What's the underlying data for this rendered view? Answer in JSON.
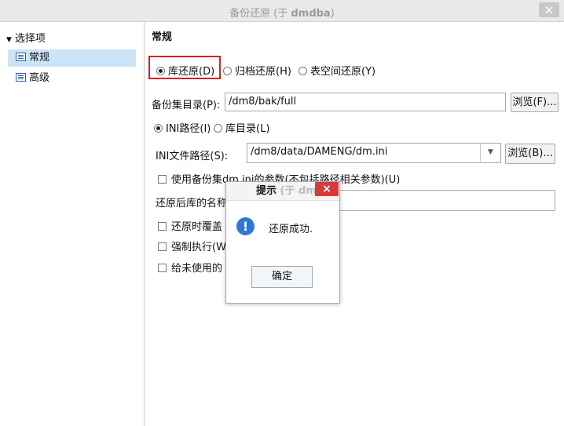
{
  "window": {
    "title_prefix": "备份还原 (于 ",
    "title_user": "dmdba",
    "title_suffix": ")",
    "close_symbol": "×"
  },
  "sidebar": {
    "root_label": "选择项",
    "items": [
      {
        "label": "常规",
        "selected": true
      },
      {
        "label": "高级",
        "selected": false
      }
    ]
  },
  "main": {
    "section_title": "常规",
    "restore_type": {
      "options": [
        {
          "label": "库还原(D)",
          "checked": true
        },
        {
          "label": "归档还原(H)",
          "checked": false
        },
        {
          "label": "表空间还原(Y)",
          "checked": false
        }
      ]
    },
    "backup_dir": {
      "label": "备份集目录(P):",
      "value": "/dm8/bak/full",
      "browse_label": "浏览(F)..."
    },
    "path_mode": {
      "options": [
        {
          "label": "INI路径(I)",
          "checked": true
        },
        {
          "label": "库目录(L)",
          "checked": false
        }
      ]
    },
    "ini_path": {
      "label": "INI文件路径(S):",
      "value": "/dm8/data/DAMENG/dm.ini",
      "browse_label": "浏览(B)..."
    },
    "use_backup_ini_label": "使用备份集dm.ini的参数(不包括路径相关参数)(U)",
    "restored_db_name_label": "还原后库的名称",
    "restored_db_name_value": "",
    "overwrite_label": "还原时覆盖",
    "force_label": "强制执行(W",
    "unused_label": "给未使用的"
  },
  "dialog": {
    "title": "提示",
    "title_extra": " (于 dm",
    "close_symbol": "×",
    "message": "还原成功.",
    "ok_label": "确定",
    "icon_glyph": "!"
  },
  "colors": {
    "highlight_box": "#e01b1b",
    "info_icon": "#2f77d6",
    "dialog_close": "#d63b3b",
    "selection": "#cce4f7"
  }
}
